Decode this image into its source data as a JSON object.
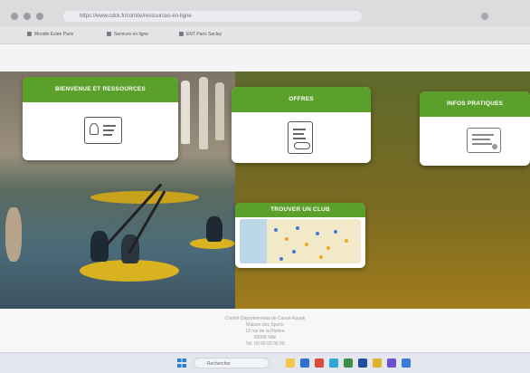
{
  "browser": {
    "address": "https://www.cdck.fr/comite/ressources-en-ligne",
    "bookmarks": [
      "Moodle Esiee Paris",
      "Services en ligne",
      "ENT Paris Saclay"
    ]
  },
  "cards": [
    {
      "title": "Bienvenue et Ressources",
      "icon": "id-card-icon"
    },
    {
      "title": "Offres",
      "icon": "contract-handshake-icon"
    },
    {
      "title": "Infos Pratiques",
      "icon": "certificate-icon"
    },
    {
      "title": "Trouver un club",
      "icon": "map-icon"
    }
  ],
  "footer": {
    "lines": [
      "Comité Départemental de Canoë-Kayak",
      "Maison des Sports",
      "12 rue de la Rivière",
      "00000 Ville",
      "Tél. 00 00 00 00 00"
    ]
  },
  "taskbar": {
    "search_placeholder": "Rechercher"
  },
  "colors": {
    "card_header": "#5ba02a",
    "hero_tint": "#7a6a22"
  }
}
